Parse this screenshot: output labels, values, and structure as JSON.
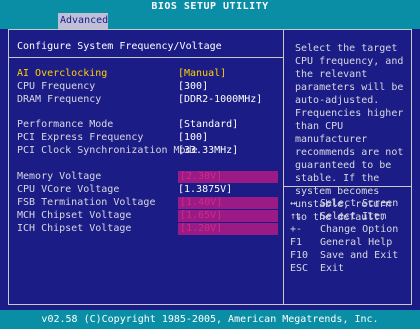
{
  "app_title": "BIOS SETUP UTILITY",
  "active_tab": "Advanced",
  "section_title": "Configure System Frequency/Voltage",
  "settings": [
    {
      "label": "AI Overclocking",
      "value": "[Manual]"
    },
    {
      "label": "CPU Frequency",
      "value": "[300]"
    },
    {
      "label": "DRAM Frequency",
      "value": "[DDR2-1000MHz]"
    },
    {
      "label": "Performance Mode",
      "value": "[Standard]"
    },
    {
      "label": "PCI Express Frequency",
      "value": "[100]"
    },
    {
      "label": "PCI Clock Synchronization Mode",
      "value": "[33.33MHz]"
    },
    {
      "label": "Memory Voltage",
      "value": "[2.30V]"
    },
    {
      "label": "CPU VCore Voltage",
      "value": "[1.3875V]"
    },
    {
      "label": "FSB Termination Voltage",
      "value": "[1.40V]"
    },
    {
      "label": "MCH Chipset Voltage",
      "value": "[1.65V]"
    },
    {
      "label": "ICH Chipset Voltage",
      "value": "[1.20V]"
    }
  ],
  "help_text": "Select the target CPU frequency, and the relevant parameters will be auto-adjusted. Frequencies higher than CPU manufacturer recommends are not guaranteed to be stable. If the system becomes unstable, return to the default.",
  "keys": [
    {
      "key": "↔",
      "desc": "Select Screen"
    },
    {
      "key": "↑↓",
      "desc": "Select Item"
    },
    {
      "key": "+-",
      "desc": "Change Option"
    },
    {
      "key": "F1",
      "desc": "General Help"
    },
    {
      "key": "F10",
      "desc": "Save and Exit"
    },
    {
      "key": "ESC",
      "desc": "Exit"
    }
  ],
  "footer": "v02.58 (C)Copyright 1985-2005, American Megatrends, Inc.",
  "colors": {
    "background": "#1b1c86",
    "bar": "#0a8ea6",
    "selected_text": "#ffd000",
    "highlight_field": "#9a1a86"
  }
}
